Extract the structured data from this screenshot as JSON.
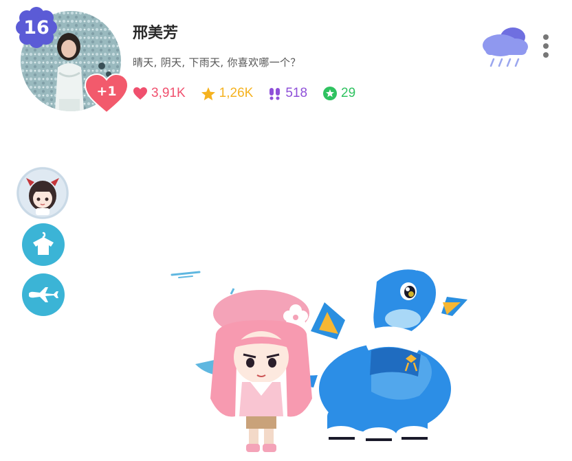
{
  "profile": {
    "level": "16",
    "name": "邢美芳",
    "status": "晴天, 阴天, 下雨天, 你喜欢哪一个？",
    "like_badge": "+1"
  },
  "stats": [
    {
      "icon": "heart-icon",
      "value": "3,91K",
      "color": "#f0506e"
    },
    {
      "icon": "star-icon",
      "value": "1,26K",
      "color": "#f5b21f"
    },
    {
      "icon": "footprints-icon",
      "value": "518",
      "color": "#8e4fd8"
    },
    {
      "icon": "flower-badge-icon",
      "value": "29",
      "color": "#2fc260"
    }
  ],
  "header_actions": {
    "weather_icon": "rain-cloud-icon",
    "menu_icon": "more-vertical-icon"
  },
  "side_menu": [
    {
      "icon": "character-avatar-icon"
    },
    {
      "icon": "wardrobe-shirt-icon"
    },
    {
      "icon": "airplane-icon"
    }
  ],
  "colors": {
    "level_badge": "#5b5bd6",
    "like_heart": "#f25a6c",
    "side_button": "#3bb4d6"
  }
}
